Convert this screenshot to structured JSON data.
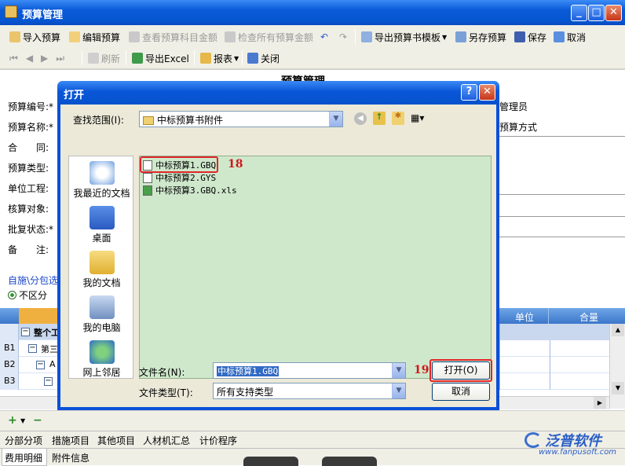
{
  "window": {
    "title": "预算管理"
  },
  "toolbar1": {
    "import": "导入预算",
    "edit": "编辑预算",
    "view_subject": "查看预算科目金额",
    "check_all": "检查所有预算金额",
    "export_template": "导出预算书模板",
    "save_as": "另存预算",
    "save": "保存",
    "cancel": "取消"
  },
  "toolbar2": {
    "refresh": "刷新",
    "export_excel": "导出Excel",
    "report": "报表",
    "close": "关闭"
  },
  "form": {
    "heading": "预算管理",
    "fields": [
      "预算编号:*",
      "预算名称:*",
      "合　　同:",
      "预算类型:",
      "单位工程:",
      "核算对象:",
      "批复状态:*",
      "备　　注:"
    ],
    "right_labels": [
      "管理员",
      "预算方式"
    ],
    "link_text": "自施\\分包选",
    "radio_label": "不区分"
  },
  "grid": {
    "col_unit": "单位",
    "col_qty": "合量",
    "rows": [
      {
        "num": "",
        "label": "整个工"
      },
      {
        "num": "B1",
        "label": "第三"
      },
      {
        "num": "B2",
        "label": "A"
      },
      {
        "num": "B3",
        "label": ""
      }
    ]
  },
  "tabs_row1": [
    "分部分项",
    "措施项目",
    "其他项目",
    "人材机汇总",
    "计价程序"
  ],
  "tabs_row2": [
    "费用明细",
    "附件信息"
  ],
  "watermark": {
    "brand": "泛普软件",
    "url": "www.fanpusoft.com"
  },
  "dialog": {
    "title": "打开",
    "lookin_label": "查找范围(I):",
    "lookin_value": "中标预算书附件",
    "places": [
      "我最近的文档",
      "桌面",
      "我的文档",
      "我的电脑",
      "网上邻居"
    ],
    "files": [
      "中标预算1.GBQ",
      "中标预算2.GYS",
      "中标预算3.GBQ.xls"
    ],
    "filename_label": "文件名(N):",
    "filename_value": "中标预算1.GBQ",
    "filetype_label": "文件类型(T):",
    "filetype_value": "所有支持类型",
    "open_button": "打开(O)",
    "cancel_button": "取消",
    "annotation_18": "18",
    "annotation_19": "19"
  },
  "colors": {
    "title_blue": "#0a5ad8",
    "annotation_red": "#e0262a",
    "filelist_green": "#cfe8cc"
  }
}
